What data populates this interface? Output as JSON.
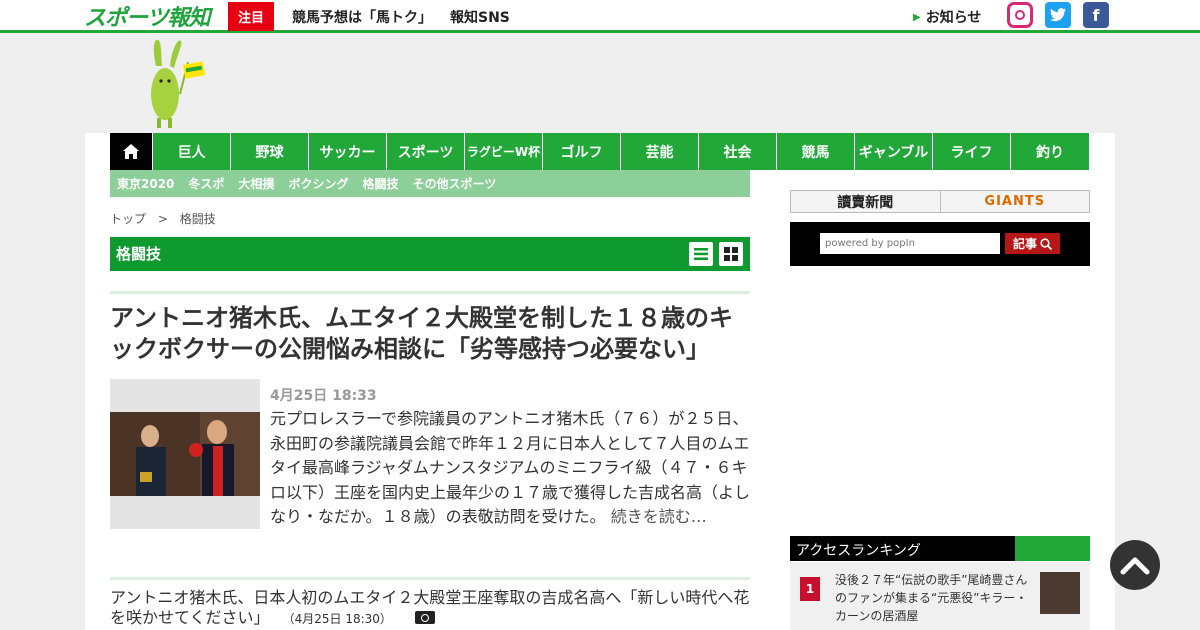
{
  "site": {
    "logo_text": "スポーツ報知"
  },
  "topbar": {
    "hot_label": "注目",
    "link1": "競馬予想は「馬トク」",
    "link2": "報知SNS",
    "notice": "お知らせ",
    "social": [
      "instagram-icon",
      "twitter-icon",
      "facebook-icon"
    ]
  },
  "nav": {
    "items": [
      "巨人",
      "野球",
      "サッカー",
      "スポーツ",
      "ラグビーW杯",
      "ゴルフ",
      "芸能",
      "社会",
      "競馬",
      "ギャンブル",
      "ライフ",
      "釣り"
    ]
  },
  "subnav": {
    "items": [
      "東京2020",
      "冬スポ",
      "大相撲",
      "ボクシング",
      "格闘技",
      "その他スポーツ"
    ]
  },
  "breadcrumb": {
    "home": "トップ",
    "sep": ">",
    "current": "格闘技"
  },
  "section": {
    "title": "格闘技"
  },
  "article": {
    "headline": "アントニオ猪木氏、ムエタイ２大殿堂を制した１８歳のキックボクサーの公開悩み相談に「劣等感持つ必要ない」",
    "date": "4月25日 18:33",
    "lead": "元プロレスラーで参院議員のアントニオ猪木氏（７６）が２５日、永田町の参議院議員会館で昨年１２月に日本人として７人目のムエタイ最高峰ラジャダムナンスタジアムのミニフライ級（４７・６キロ以下）王座を国内史上最年少の１７歳で獲得した吉成名高（よしなり・なだか。１８歳）の表敬訪問を受けた。",
    "more": "続きを読む…"
  },
  "related": {
    "title": "アントニオ猪木氏、日本人初のムエタイ２大殿堂王座奪取の吉成名高へ「新しい時代へ花を咲かせてください」",
    "date": "（4月25日 18:30）"
  },
  "sidebar": {
    "banner1": "讀賣新聞",
    "banner2": "GIANTS",
    "search_placeholder": "powered by popIn",
    "search_button": "記事",
    "ranking_title": "アクセスランキング",
    "ranking": [
      {
        "rank": "1",
        "text": "没後２７年“伝説の歌手”尾崎豊さんのファンが集まる“元悪役”キラー・カーンの居酒屋"
      }
    ]
  },
  "colors": {
    "brand_green": "#22a838",
    "dark_green": "#0e9a2f",
    "light_green": "#8ccf98",
    "red": "#e60012"
  }
}
